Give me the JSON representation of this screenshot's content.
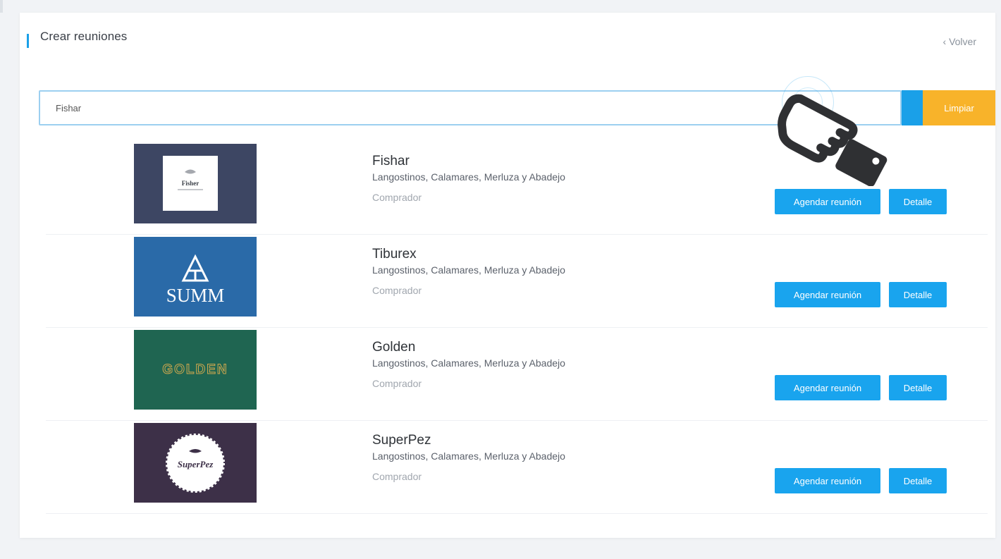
{
  "header": {
    "title": "Crear reuniones",
    "back_label": "‹ Volver"
  },
  "search": {
    "value": "Fishar",
    "clear_label": "Limpiar"
  },
  "results": [
    {
      "name": "Fishar",
      "description": "Langostinos, Calamares, Merluza y Abadejo",
      "role": "Comprador",
      "logo_text": "Fisher",
      "logo_color": "#3d4663",
      "schedule_label": "Agendar reunión",
      "detail_label": "Detalle"
    },
    {
      "name": "Tiburex",
      "description": "Langostinos, Calamares, Merluza y Abadejo",
      "role": "Comprador",
      "logo_text": "SUMM",
      "logo_color": "#2a6aa8",
      "schedule_label": "Agendar reunión",
      "detail_label": "Detalle"
    },
    {
      "name": "Golden",
      "description": "Langostinos, Calamares, Merluza y Abadejo",
      "role": "Comprador",
      "logo_text": "GOLDEN",
      "logo_color": "#1f6551",
      "schedule_label": "Agendar reunión",
      "detail_label": "Detalle"
    },
    {
      "name": "SuperPez",
      "description": "Langostinos, Calamares, Merluza y Abadejo",
      "role": "Comprador",
      "logo_text": "SuperPez",
      "logo_color": "#3d3048",
      "schedule_label": "Agendar reunión",
      "detail_label": "Detalle"
    }
  ],
  "colors": {
    "accent": "#19a4ee",
    "clear": "#f8b32a"
  }
}
